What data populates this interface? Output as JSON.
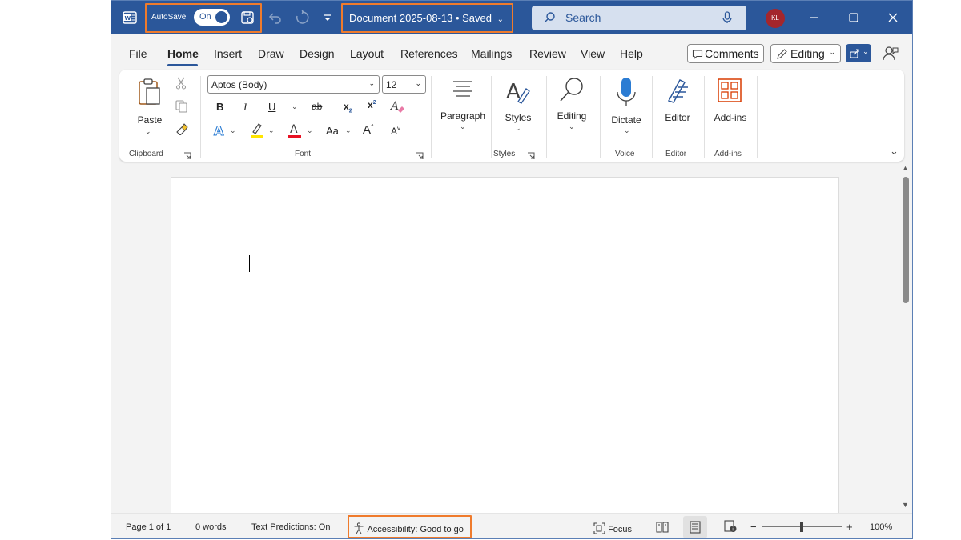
{
  "title_bar": {
    "autosave_label": "AutoSave",
    "autosave_state": "On",
    "document_title": "Document 2025-08-13 • Saved",
    "search_placeholder": "Search",
    "user_initials": "KL",
    "accent_color": "#2b579a",
    "highlight_color": "#ef7b2c"
  },
  "tabs": [
    "File",
    "Home",
    "Insert",
    "Draw",
    "Design",
    "Layout",
    "References",
    "Mailings",
    "Review",
    "View",
    "Help"
  ],
  "active_tab": "Home",
  "tab_actions": {
    "comments_label": "Comments",
    "editing_label": "Editing"
  },
  "ribbon": {
    "clipboard": {
      "paste_label": "Paste",
      "group_label": "Clipboard"
    },
    "font": {
      "font_name": "Aptos (Body)",
      "font_size": "12",
      "bold": "B",
      "italic": "I",
      "underline": "U",
      "strikethrough": "ab",
      "subscript": "x",
      "superscript": "x",
      "change_case": "Aa",
      "grow_font": "A",
      "shrink_font": "A",
      "group_label": "Font"
    },
    "paragraph": {
      "label": "Paragraph"
    },
    "styles": {
      "label": "Styles",
      "group_label": "Styles"
    },
    "editing": {
      "label": "Editing"
    },
    "voice": {
      "dictate_label": "Dictate",
      "group_label": "Voice"
    },
    "editor": {
      "label": "Editor",
      "group_label": "Editor"
    },
    "addins": {
      "label": "Add-ins",
      "group_label": "Add-ins"
    }
  },
  "status_bar": {
    "page": "Page 1 of 1",
    "words": "0 words",
    "text_predictions": "Text Predictions: On",
    "accessibility": "Accessibility: Good to go",
    "focus": "Focus",
    "zoom_minus": "−",
    "zoom_plus": "+",
    "zoom_level": "100%"
  }
}
